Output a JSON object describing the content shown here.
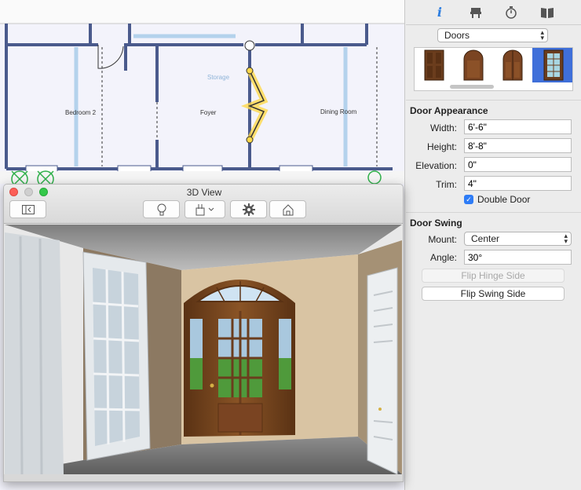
{
  "floorplan": {
    "rooms": {
      "bedroom": "Bedroom 2",
      "foyer": "Foyer",
      "dining": "Dining Room",
      "storage": "Storage"
    }
  },
  "inspector": {
    "tabs": [
      {
        "icon": "info-icon",
        "label": "i"
      },
      {
        "icon": "chair-icon",
        "label": ""
      },
      {
        "icon": "stopwatch-icon",
        "label": ""
      },
      {
        "icon": "book-icon",
        "label": ""
      }
    ],
    "category_select": "Doors",
    "gallery": [
      "panel-door",
      "arched-door",
      "arched-door-2",
      "glass-door"
    ],
    "door_appearance": {
      "title": "Door Appearance",
      "width_label": "Width:",
      "width": "6'-6\"",
      "height_label": "Height:",
      "height": "8'-8\"",
      "elevation_label": "Elevation:",
      "elevation": "0\"",
      "trim_label": "Trim:",
      "trim": "4\"",
      "double_door_label": "Double Door",
      "double_door_checked": true
    },
    "door_swing": {
      "title": "Door Swing",
      "mount_label": "Mount:",
      "mount": "Center",
      "angle_label": "Angle:",
      "angle": "30°",
      "flip_hinge": "Flip Hinge Side",
      "flip_swing": "Flip Swing Side"
    }
  },
  "view3d": {
    "title": "3D View",
    "colors": {
      "close": "#fc5f57",
      "minimize": "#cfcfcf",
      "zoom": "#34c84a",
      "accent": "#2e7cf6"
    }
  }
}
